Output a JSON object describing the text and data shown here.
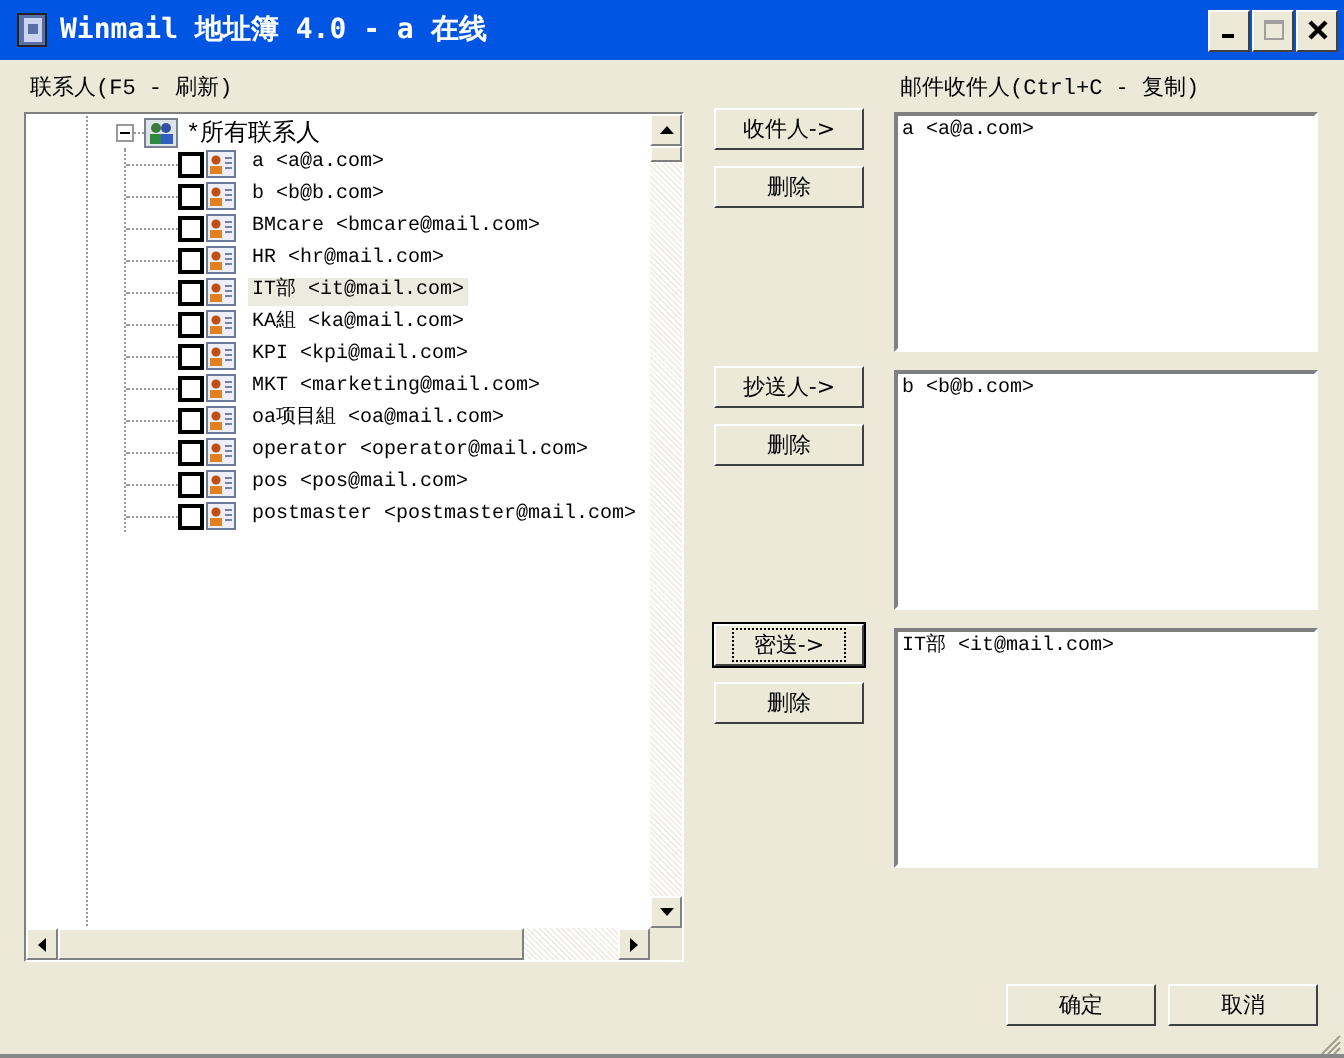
{
  "window": {
    "title": "Winmail 地址簿 4.0 - a 在线"
  },
  "contacts": {
    "label": "联系人(F5 - 刷新)",
    "root": {
      "label": "*所有联系人",
      "expanded": true,
      "children": [
        {
          "label": "a <a@a.com>",
          "checked": false,
          "selected": false
        },
        {
          "label": "b <b@b.com>",
          "checked": false,
          "selected": false
        },
        {
          "label": "BMcare <bmcare@mail.com>",
          "checked": false,
          "selected": false
        },
        {
          "label": "HR <hr@mail.com>",
          "checked": false,
          "selected": false
        },
        {
          "label": "IT部 <it@mail.com>",
          "checked": false,
          "selected": true
        },
        {
          "label": "KA組 <ka@mail.com>",
          "checked": false,
          "selected": false
        },
        {
          "label": "KPI <kpi@mail.com>",
          "checked": false,
          "selected": false
        },
        {
          "label": "MKT <marketing@mail.com>",
          "checked": false,
          "selected": false
        },
        {
          "label": "oa项目組 <oa@mail.com>",
          "checked": false,
          "selected": false
        },
        {
          "label": "operator <operator@mail.com>",
          "checked": false,
          "selected": false
        },
        {
          "label": "pos <pos@mail.com>",
          "checked": false,
          "selected": false
        },
        {
          "label": "postmaster <postmaster@mail.com>",
          "checked": false,
          "selected": false
        }
      ]
    }
  },
  "recipients": {
    "label": "邮件收件人(Ctrl+C - 复制)",
    "groups": [
      {
        "add_button": "收件人->",
        "remove_button": "删除",
        "focused": false,
        "entries": [
          "a <a@a.com>"
        ]
      },
      {
        "add_button": "抄送人->",
        "remove_button": "删除",
        "focused": false,
        "entries": [
          "b <b@b.com>"
        ]
      },
      {
        "add_button": "密送->",
        "remove_button": "删除",
        "focused": true,
        "entries": [
          "IT部 <it@mail.com>"
        ]
      }
    ]
  },
  "buttons": [
    "确定",
    "取消"
  ]
}
